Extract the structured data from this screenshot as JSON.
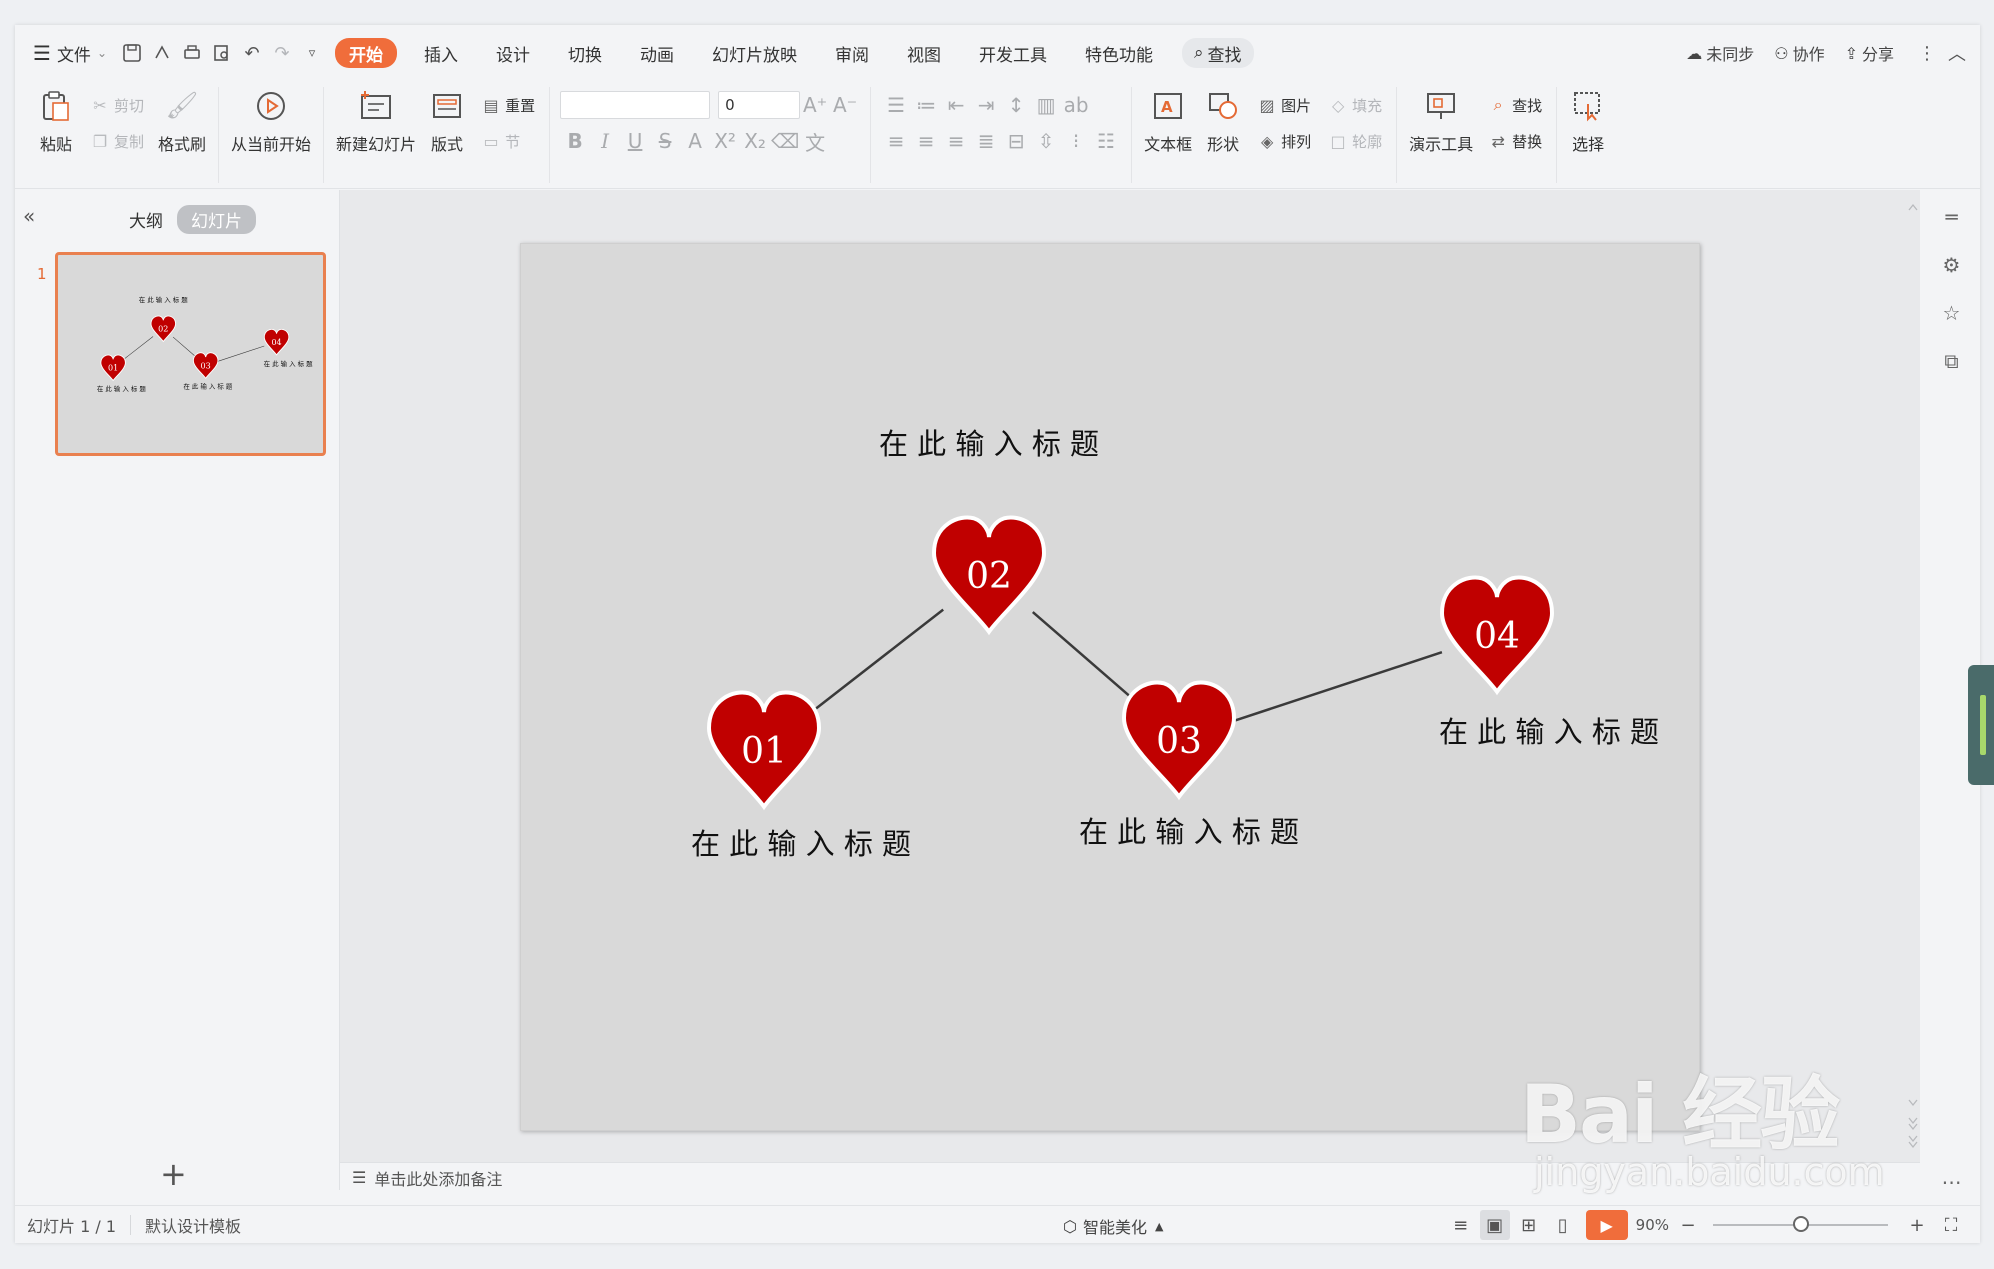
{
  "menubar": {
    "file_label": "文件",
    "tabs": [
      {
        "label": "开始",
        "active": true
      },
      {
        "label": "插入"
      },
      {
        "label": "设计"
      },
      {
        "label": "切换"
      },
      {
        "label": "动画"
      },
      {
        "label": "幻灯片放映"
      },
      {
        "label": "审阅"
      },
      {
        "label": "视图"
      },
      {
        "label": "开发工具"
      },
      {
        "label": "特色功能"
      }
    ],
    "search_label": "查找",
    "sync_label": "未同步",
    "collab_label": "协作",
    "share_label": "分享"
  },
  "ribbon": {
    "paste": "粘贴",
    "cut": "剪切",
    "copy": "复制",
    "format_painter": "格式刷",
    "from_current": "从当前开始",
    "new_slide": "新建幻灯片",
    "layout": "版式",
    "reset": "重置",
    "section": "节",
    "font_name": "",
    "font_size": "0",
    "textbox": "文本框",
    "shape": "形状",
    "picture": "图片",
    "fill": "填充",
    "arrange": "排列",
    "outline": "轮廓",
    "present_tools": "演示工具",
    "find": "查找",
    "replace": "替换",
    "select": "选择"
  },
  "leftpane": {
    "outline_tab": "大纲",
    "slides_tab": "幻灯片",
    "slide_number": "1"
  },
  "slide": {
    "hearts": [
      {
        "num": "01",
        "caption": "在 此 输 入 标 题"
      },
      {
        "num": "02",
        "caption": "在 此 输 入 标 题"
      },
      {
        "num": "03",
        "caption": "在 此 输 入 标 题"
      },
      {
        "num": "04",
        "caption": "在 此 输 入 标 题"
      }
    ],
    "heart_color": "#c00000",
    "background": "#d9d9d9"
  },
  "notes": {
    "placeholder": "单击此处添加备注"
  },
  "status": {
    "slide_count": "幻灯片 1 / 1",
    "template": "默认设计模板",
    "beautify": "智能美化",
    "zoom": "90%"
  },
  "watermark": {
    "brand": "Bai 经验",
    "url": "jingyan.baidu.com"
  }
}
